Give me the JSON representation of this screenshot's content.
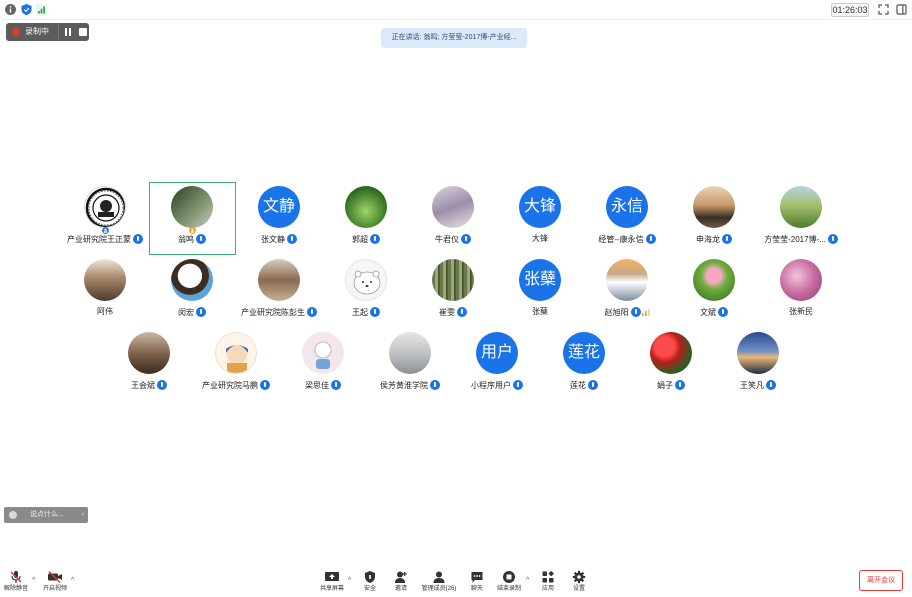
{
  "topbar": {
    "timer": "01:26:03"
  },
  "recording": {
    "label": "录制中"
  },
  "speaking": {
    "text": "正在讲话: 翁鸣; 方莹莹-2017博-产业经..."
  },
  "participants": [
    {
      "name": "产业研究院王正蒙"
    },
    {
      "name": "翁鸣"
    },
    {
      "name": "张文静",
      "avatar_text": "文静"
    },
    {
      "name": "郭超"
    },
    {
      "name": "牛君仪"
    },
    {
      "name": "大锋",
      "avatar_text": "大锋"
    },
    {
      "name": "经管--康永信",
      "avatar_text": "永信"
    },
    {
      "name": "申海龙"
    },
    {
      "name": "方莹莹-2017博-..."
    },
    {
      "name": "阿伟"
    },
    {
      "name": "闵宏"
    },
    {
      "name": "产业研究院陈彭生"
    },
    {
      "name": "王起"
    },
    {
      "name": "崔雯"
    },
    {
      "name": "张蘖",
      "avatar_text": "张蘖"
    },
    {
      "name": "赵旭阳"
    },
    {
      "name": "文斌"
    },
    {
      "name": "张新民"
    },
    {
      "name": "王会斌"
    },
    {
      "name": "产业研究院马鹏"
    },
    {
      "name": "梁思佳"
    },
    {
      "name": "侯芳黄淮学院"
    },
    {
      "name": "小程序用户",
      "avatar_text": "用户"
    },
    {
      "name": "莲花",
      "avatar_text": "莲花"
    },
    {
      "name": "娟子"
    },
    {
      "name": "王笑凡"
    }
  ],
  "chat": {
    "placeholder": "说点什么...",
    "arrow": "‹"
  },
  "toolbar": {
    "unmute": "解除静音",
    "start_video": "开启视频",
    "share": "共享屏幕",
    "security": "安全",
    "invite": "邀请",
    "members": "管理成员(26)",
    "chat": "聊天",
    "end_recording": "结束录制",
    "apps": "应用",
    "settings": "设置",
    "leave": "离开会议",
    "caret": "^"
  },
  "colors": {
    "accent": "#1a73e8",
    "danger": "#e53935",
    "speaking_bg": "#dce9fb",
    "selected_border": "#3cb371"
  }
}
